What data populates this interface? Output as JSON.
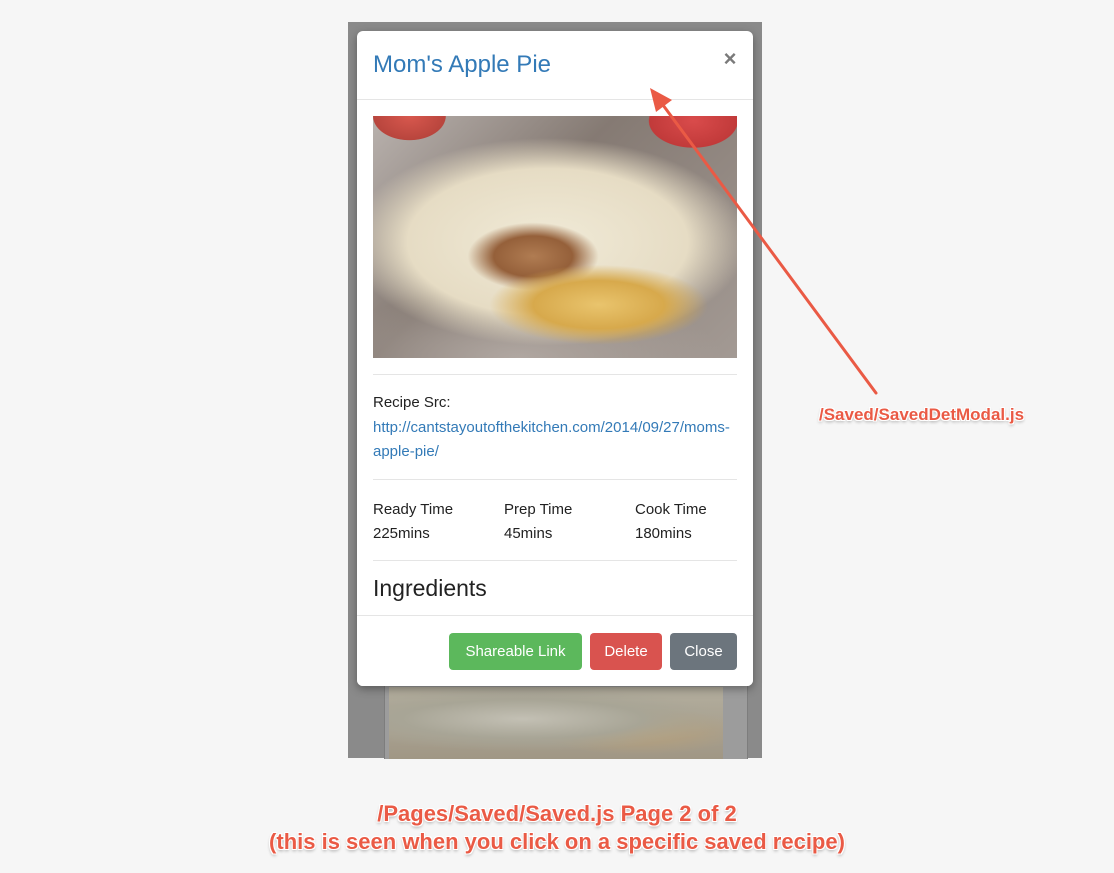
{
  "modal": {
    "title": "Mom's Apple Pie",
    "close_glyph": "×",
    "recipe_src_label": "Recipe Src:",
    "recipe_src_url": "http://cantstayoutofthekitchen.com/2014/09/27/moms-apple-pie/",
    "times": [
      {
        "label": "Ready Time",
        "value": "225mins"
      },
      {
        "label": "Prep Time",
        "value": "45mins"
      },
      {
        "label": "Cook Time",
        "value": "180mins"
      }
    ],
    "ingredients_heading": "Ingredients",
    "buttons": {
      "shareable": "Shareable Link",
      "delete": "Delete",
      "close": "Close"
    }
  },
  "annotations": {
    "modal_file": "/Saved/SavedDetModal.js",
    "page_caption_line1": "/Pages/Saved/Saved.js Page 2 of 2",
    "page_caption_line2": "(this is seen when you click on a specific saved recipe)"
  },
  "colors": {
    "title_link": "#337ab7",
    "btn_share": "#5cb85c",
    "btn_delete": "#d9534f",
    "btn_close": "#6c757d",
    "annotation": "#ea5a45"
  },
  "icons": {
    "close": "close-icon",
    "arrow": "annotation-arrow-icon"
  }
}
